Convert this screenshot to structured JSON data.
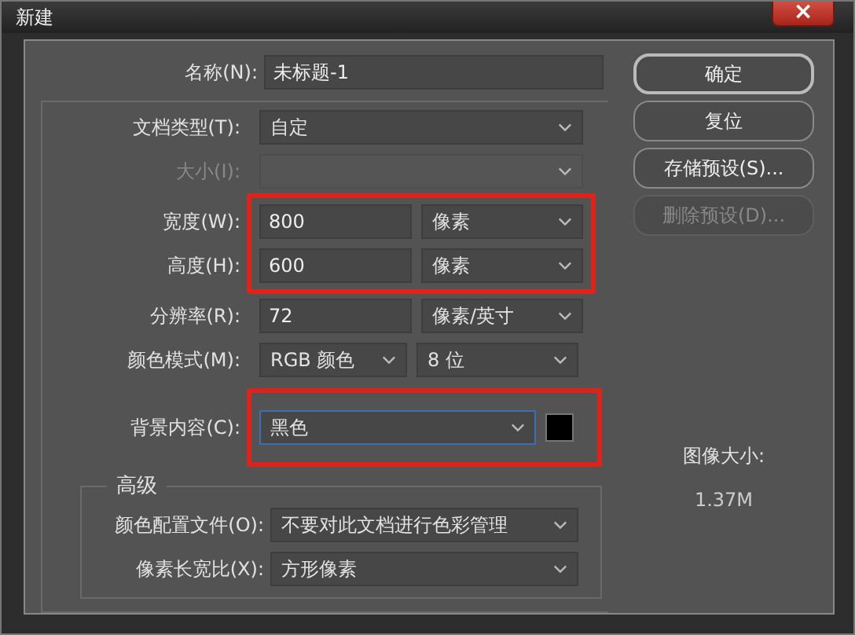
{
  "window": {
    "title": "新建",
    "close_label": "×"
  },
  "name_field": {
    "label": "名称(N):",
    "value": "未标题-1"
  },
  "rows": [
    {
      "kind": "select",
      "label": "文档类型(T):",
      "value": "自定",
      "disabled": false,
      "highlighted": false
    },
    {
      "kind": "select",
      "label": "大小(I):",
      "value": "",
      "disabled": true,
      "highlighted": false
    },
    {
      "kind": "value_unit",
      "label": "宽度(W):",
      "value": "800",
      "unit": "像素",
      "disabled": false,
      "highlighted": true
    },
    {
      "kind": "value_unit",
      "label": "高度(H):",
      "value": "600",
      "unit": "像素",
      "disabled": false,
      "highlighted": true
    },
    {
      "kind": "value_unit",
      "label": "分辨率(R):",
      "value": "72",
      "unit": "像素/英寸",
      "disabled": false,
      "highlighted": false
    },
    {
      "kind": "select_pair",
      "label": "颜色模式(M):",
      "value": "RGB 颜色",
      "unit": "8 位",
      "disabled": false,
      "highlighted": false
    },
    {
      "kind": "select_swatch",
      "label": "背景内容(C):",
      "value": "黑色",
      "color": "#000000",
      "focused": true,
      "disabled": false,
      "highlighted": true
    }
  ],
  "advanced": {
    "title": "高级",
    "rows": [
      {
        "label": "颜色配置文件(O):",
        "value": "不要对此文档进行色彩管理"
      },
      {
        "label": "像素长宽比(X):",
        "value": "方形像素"
      }
    ]
  },
  "buttons": [
    {
      "label": "确定",
      "default": true,
      "disabled": false
    },
    {
      "label": "复位",
      "default": false,
      "disabled": false
    },
    {
      "label": "存储预设(S)...",
      "default": false,
      "disabled": false
    },
    {
      "label": "删除预设(D)...",
      "default": false,
      "disabled": true
    }
  ],
  "image_size": {
    "label": "图像大小:",
    "value": "1.37M"
  }
}
